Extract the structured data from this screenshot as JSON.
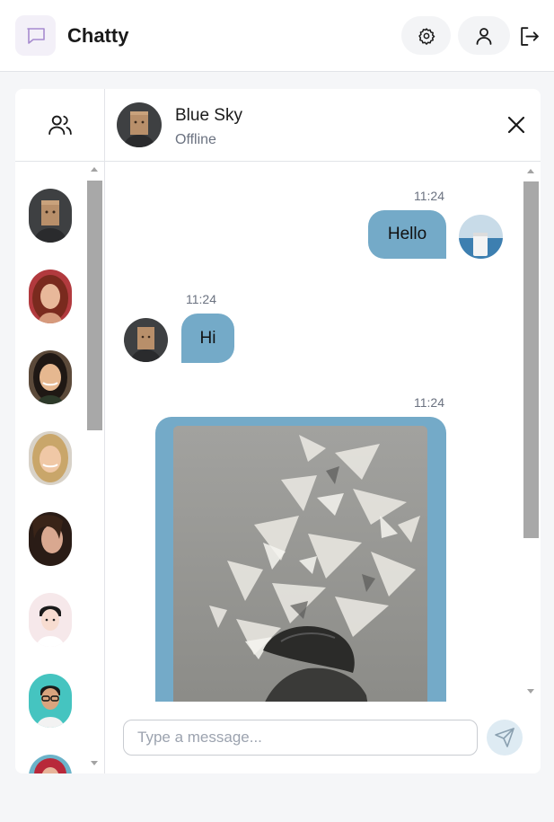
{
  "app": {
    "title": "Chatty"
  },
  "header": {
    "logo_icon": "chat-bubble-icon",
    "settings_icon": "gear-icon",
    "profile_icon": "user-icon",
    "logout_icon": "logout-icon"
  },
  "sidebar": {
    "header_icon": "users-icon",
    "contacts": [
      {
        "icon": "avatar-paper-bag"
      },
      {
        "icon": "avatar-red-hair-woman"
      },
      {
        "icon": "avatar-asian-woman"
      },
      {
        "icon": "avatar-blonde-woman"
      },
      {
        "icon": "avatar-brunette-woman"
      },
      {
        "icon": "avatar-illustrated-man"
      },
      {
        "icon": "avatar-glasses-man"
      },
      {
        "icon": "avatar-red-hair-partial"
      }
    ]
  },
  "chat": {
    "contact_name": "Blue Sky",
    "contact_status": "Offline",
    "close_icon": "close-icon",
    "messages": [
      {
        "time": "11:24",
        "text": "Hello",
        "from": "me"
      },
      {
        "time": "11:24",
        "text": "Hi",
        "from": "them"
      },
      {
        "time": "11:24",
        "text": "",
        "from": "me",
        "attachment": "image"
      }
    ]
  },
  "composer": {
    "placeholder": "Type a message...",
    "send_icon": "send-icon"
  },
  "colors": {
    "bubble": "#74aac8",
    "send_button_bg": "#deebf3",
    "logo_bg": "#f3f0f8"
  }
}
